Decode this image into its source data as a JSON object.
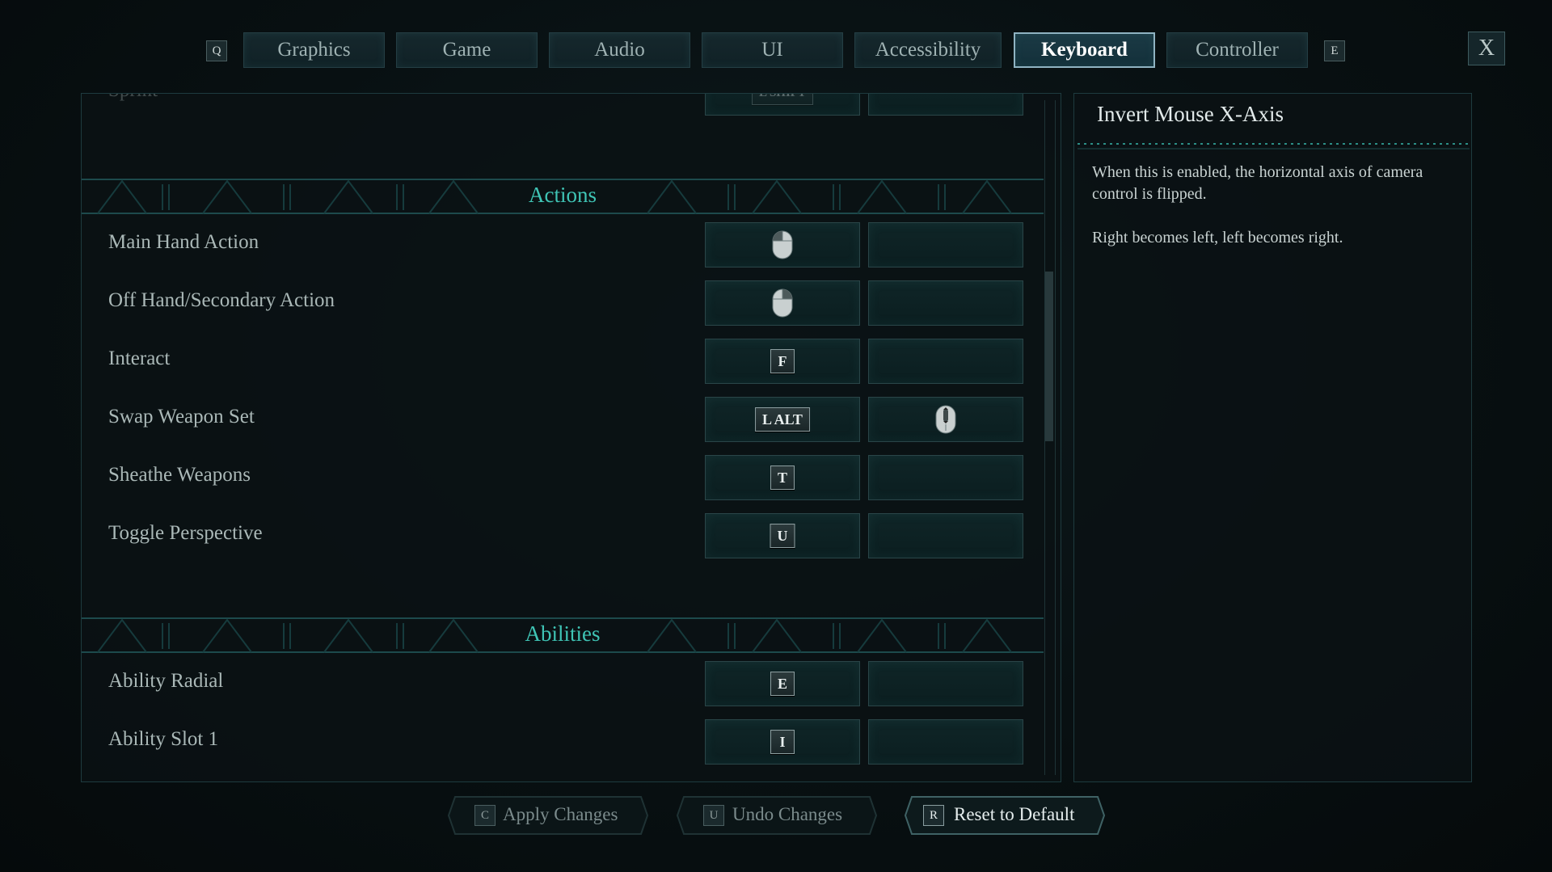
{
  "tabs": {
    "prev_key": "Q",
    "next_key": "E",
    "items": [
      "Graphics",
      "Game",
      "Audio",
      "UI",
      "Accessibility",
      "Keyboard",
      "Controller"
    ],
    "active": "Keyboard",
    "close_label": "X"
  },
  "bindings": {
    "partial_row": {
      "label": "Sprint",
      "primary_key": "L SHIFT"
    },
    "sections": [
      {
        "title": "Actions",
        "rows": [
          {
            "label": "Main Hand Action",
            "primary_icon": "mouse-left-icon"
          },
          {
            "label": "Off Hand/Secondary Action",
            "primary_icon": "mouse-right-icon"
          },
          {
            "label": "Interact",
            "primary_key": "F"
          },
          {
            "label": "Swap Weapon Set",
            "primary_key": "L ALT",
            "secondary_icon": "mouse-wheel-icon"
          },
          {
            "label": "Sheathe Weapons",
            "primary_key": "T"
          },
          {
            "label": "Toggle Perspective",
            "primary_key": "U"
          }
        ]
      },
      {
        "title": "Abilities",
        "rows": [
          {
            "label": "Ability Radial",
            "primary_key": "E"
          },
          {
            "label": "Ability Slot 1",
            "primary_key": "I"
          }
        ]
      }
    ]
  },
  "description": {
    "title": "Invert Mouse X-Axis",
    "paragraph_1": "When this is enabled, the horizontal axis of camera control is flipped.",
    "paragraph_2": "Right becomes left, left becomes right."
  },
  "footer": {
    "apply": {
      "key": "C",
      "label": "Apply Changes",
      "enabled": false
    },
    "undo": {
      "key": "U",
      "label": "Undo Changes",
      "enabled": false
    },
    "reset": {
      "key": "R",
      "label": "Reset to Default",
      "enabled": true
    }
  },
  "colors": {
    "accent_teal": "#3fc4b5",
    "background": "#081012",
    "active_tab_border": "#8fb3c2"
  }
}
